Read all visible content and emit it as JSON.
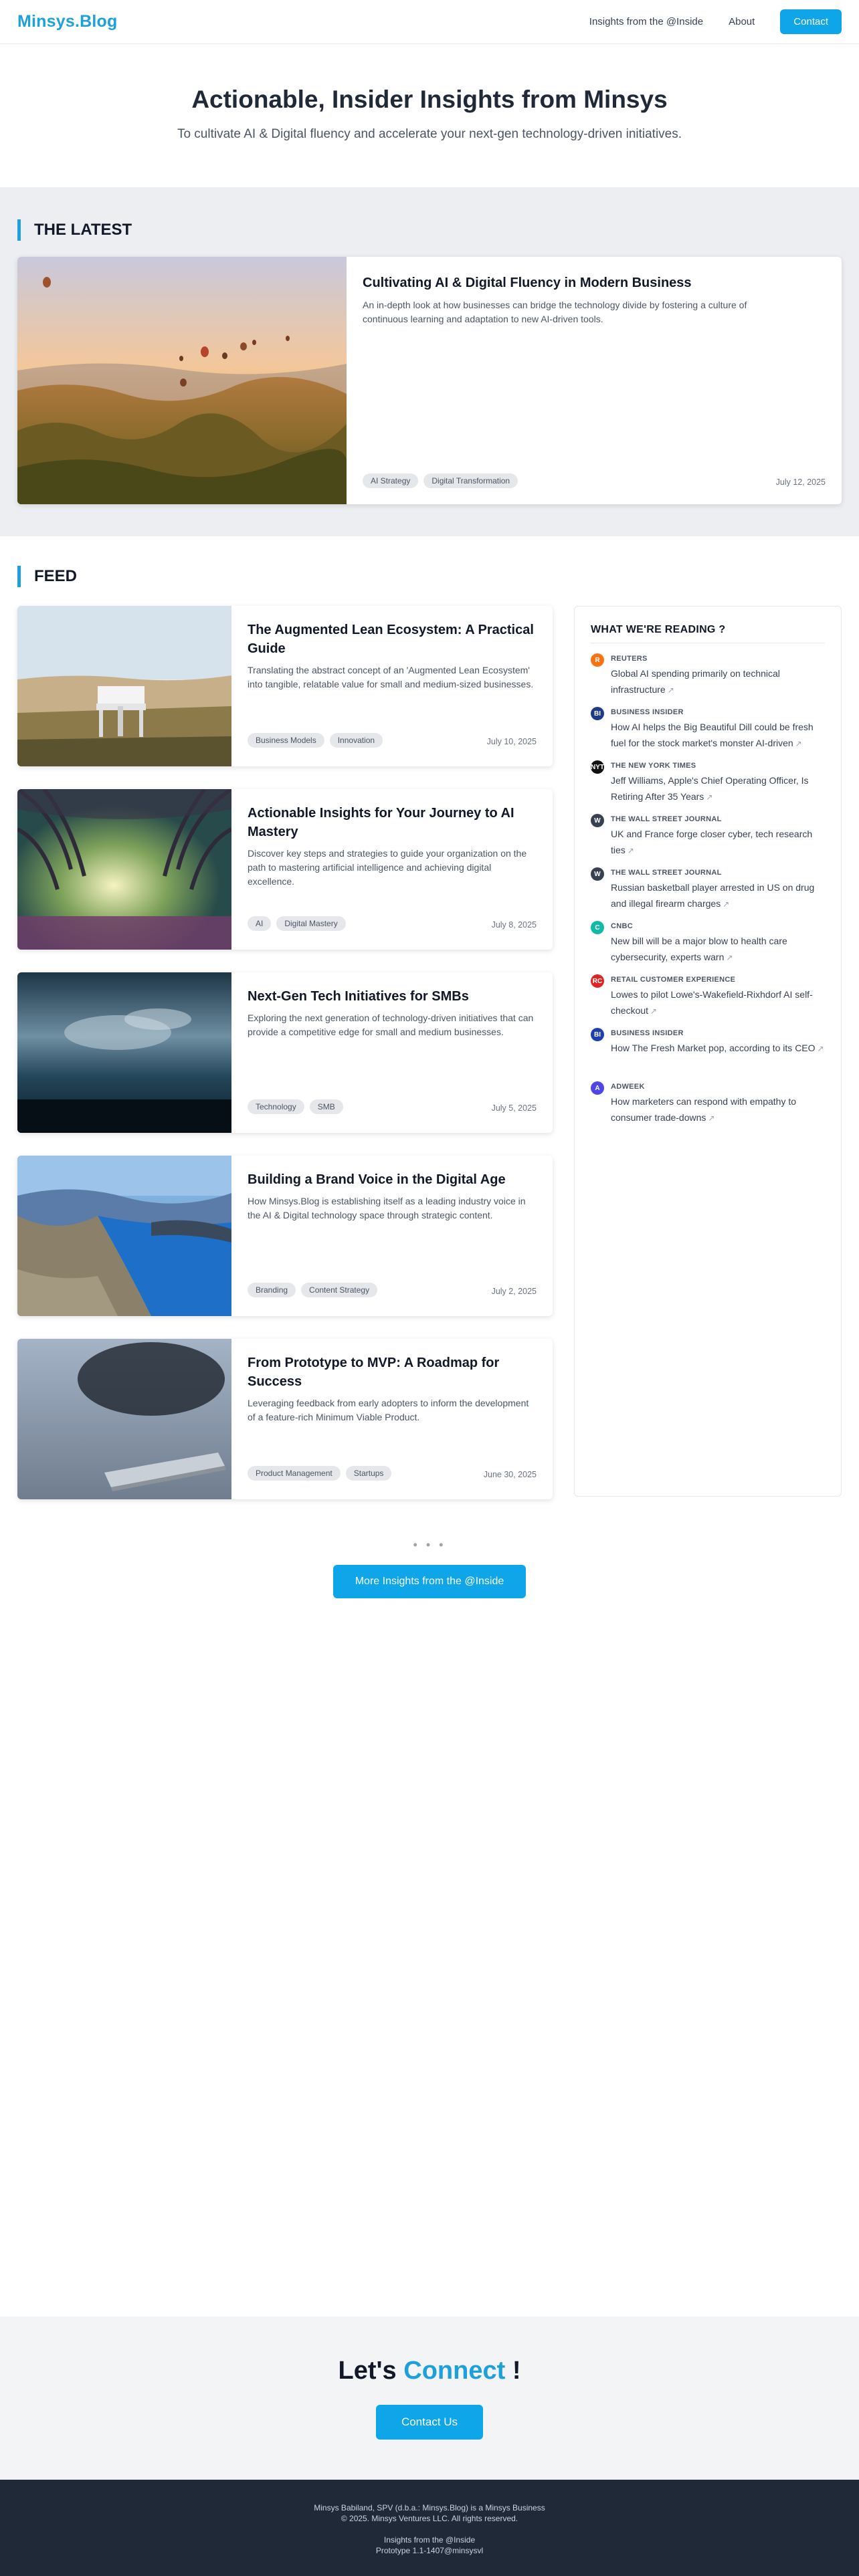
{
  "header": {
    "logo": "Minsys.Blog",
    "nav": [
      "Insights from the @Inside",
      "About"
    ],
    "contact": "Contact"
  },
  "hero": {
    "title": "Actionable, Insider Insights from Minsys",
    "subtitle": "To cultivate AI & Digital fluency and accelerate your next-gen technology-driven initiatives."
  },
  "latest": {
    "section_title": "THE LATEST",
    "title": "Cultivating AI & Digital Fluency in Modern Business",
    "description": "An in-depth look at how businesses can bridge the technology divide by fostering a culture of continuous learning and adaptation to new AI-driven tools.",
    "tags": [
      "AI Strategy",
      "Digital Transformation"
    ],
    "date": "July 12, 2025"
  },
  "feed": {
    "section_title": "FEED",
    "items": [
      {
        "title": "The Augmented Lean Ecosystem: A Practical Guide",
        "description": "Translating the abstract concept of an 'Augmented Lean Ecosystem' into tangible, relatable value for small and medium-sized businesses.",
        "tags": [
          "Business Models",
          "Innovation"
        ],
        "date": "July 10, 2025"
      },
      {
        "title": "Actionable Insights for Your Journey to AI Mastery",
        "description": "Discover key steps and strategies to guide your organization on the path to mastering artificial intelligence and achieving digital excellence.",
        "tags": [
          "AI",
          "Digital Mastery"
        ],
        "date": "July 8, 2025"
      },
      {
        "title": "Next-Gen Tech Initiatives for SMBs",
        "description": "Exploring the next generation of technology-driven initiatives that can provide a competitive edge for small and medium businesses.",
        "tags": [
          "Technology",
          "SMB"
        ],
        "date": "July 5, 2025"
      },
      {
        "title": "Building a Brand Voice in the Digital Age",
        "description": "How Minsys.Blog is establishing itself as a leading industry voice in the AI & Digital technology space through strategic content.",
        "tags": [
          "Branding",
          "Content Strategy"
        ],
        "date": "July 2, 2025"
      },
      {
        "title": "From Prototype to MVP: A Roadmap for Success",
        "description": "Leveraging feedback from early adopters to inform the development of a feature-rich Minimum Viable Product.",
        "tags": [
          "Product Management",
          "Startups"
        ],
        "date": "June 30, 2025"
      }
    ]
  },
  "reading": {
    "title": "WHAT WE'RE READING ?",
    "items": [
      {
        "source": "REUTERS",
        "headline": "Global AI spending primarily on technical infrastructure",
        "icon": "R",
        "color": "#f97316"
      },
      {
        "source": "BUSINESS INSIDER",
        "headline": "How AI helps the Big Beautiful Dill could be fresh fuel for the stock market's monster AI-driven",
        "icon": "BI",
        "color": "#1e3a8a"
      },
      {
        "source": "THE NEW YORK TIMES",
        "headline": "Jeff Williams, Apple's Chief Operating Officer, Is Retiring After 35 Years",
        "icon": "NYT",
        "color": "#111111"
      },
      {
        "source": "THE WALL STREET JOURNAL",
        "headline": "UK and France forge closer cyber, tech research ties",
        "icon": "W",
        "color": "#374151"
      },
      {
        "source": "THE WALL STREET JOURNAL",
        "headline": "Russian basketball player arrested in US on drug and illegal firearm charges",
        "icon": "W",
        "color": "#374151"
      },
      {
        "source": "CNBC",
        "headline": "New bill will be a major blow to health care cybersecurity, experts warn",
        "icon": "C",
        "color": "#14b8a6"
      },
      {
        "source": "RETAIL CUSTOMER EXPERIENCE",
        "headline": "Lowes to pilot Lowe's-Wakefield-Rixhdorf AI self-checkout",
        "icon": "RC",
        "color": "#dc2626"
      },
      {
        "source": "BUSINESS INSIDER",
        "headline": "How The Fresh Market pop, according to its CEO",
        "icon": "BI",
        "color": "#1e40af"
      },
      {
        "source": "ADWEEK",
        "headline": "How marketers can respond with empathy to consumer trade-downs",
        "icon": "A",
        "color": "#4f46e5"
      }
    ]
  },
  "more": {
    "dots": "• • •",
    "button": "More Insights from the @Inside"
  },
  "connect": {
    "prefix": "Let's",
    "highlight": "Connect",
    "suffix": "!",
    "button": "Contact Us"
  },
  "footer": {
    "line1": "Minsys Babiland, SPV (d.b.a.: Minsys.Blog) is a Minsys Business",
    "line2": "© 2025. Minsys Ventures LLC. All rights reserved.",
    "line3": "Insights from the @Inside",
    "line4": "Prototype 1.1-1407@minsysvl"
  }
}
